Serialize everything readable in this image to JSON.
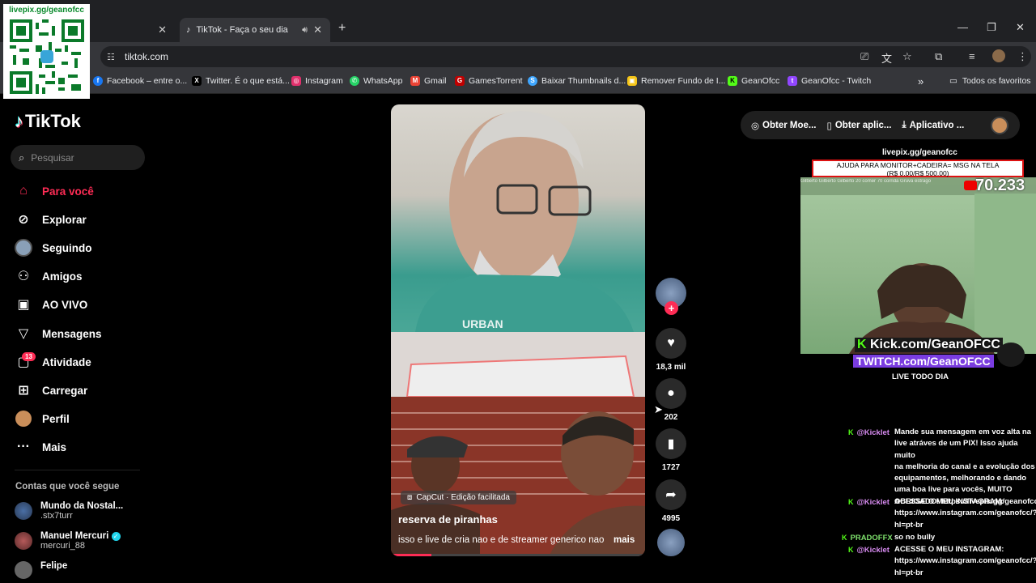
{
  "browser": {
    "tabs": [
      {
        "label": ""
      },
      {
        "label": "TikTok - Faça o seu dia"
      }
    ],
    "url": "tiktok.com",
    "bookmarks": [
      {
        "label": "Facebook – entre o...",
        "icon": "facebook-icon",
        "color": "#1877f2"
      },
      {
        "label": "Twitter. É o que está...",
        "icon": "x-icon",
        "color": "#000000"
      },
      {
        "label": "Instagram",
        "icon": "instagram-icon",
        "color": "#e1306c"
      },
      {
        "label": "WhatsApp",
        "icon": "whatsapp-icon",
        "color": "#25d366"
      },
      {
        "label": "Gmail",
        "icon": "gmail-icon",
        "color": "#ea4335"
      },
      {
        "label": "GamesTorrent",
        "icon": "gamestorrent-icon",
        "color": "#c00000"
      },
      {
        "label": "Baixar Thumbnails d...",
        "icon": "thumbnail-icon",
        "color": "#3ea6ff"
      },
      {
        "label": "Remover Fundo de I...",
        "icon": "remove-bg-icon",
        "color": "#f5c518"
      },
      {
        "label": "GeanOfcc",
        "icon": "kick-icon",
        "color": "#53fc18"
      },
      {
        "label": "GeanOfcc - Twitch",
        "icon": "twitch-icon",
        "color": "#9146ff"
      }
    ],
    "all_bookmarks": "Todos os favoritos"
  },
  "qr": {
    "text": "livepix.gg/geanofcc"
  },
  "sidebar": {
    "logo": "TikTok",
    "search_placeholder": "Pesquisar",
    "nav": [
      {
        "label": "Para você",
        "icon": "home-icon",
        "active": true
      },
      {
        "label": "Explorar",
        "icon": "compass-icon"
      },
      {
        "label": "Seguindo",
        "icon": "avatar-icon"
      },
      {
        "label": "Amigos",
        "icon": "friends-icon"
      },
      {
        "label": "AO VIVO",
        "icon": "live-icon"
      },
      {
        "label": "Mensagens",
        "icon": "message-icon"
      },
      {
        "label": "Atividade",
        "icon": "activity-icon",
        "badge": "13"
      },
      {
        "label": "Carregar",
        "icon": "upload-icon"
      },
      {
        "label": "Perfil",
        "icon": "profile-icon"
      },
      {
        "label": "Mais",
        "icon": "more-icon"
      }
    ],
    "following_title": "Contas que você segue",
    "accounts": [
      {
        "name": "Mundo da Nostal...",
        "user": ".stx7turr"
      },
      {
        "name": "Manuel Mercuri",
        "user": "mercuri_88",
        "verified": true
      },
      {
        "name": "Felipe",
        "user": ""
      }
    ]
  },
  "video": {
    "capcut_label": "CapCut · Edição facilitada",
    "title": "reserva de piranhas",
    "description": "isso e live de cria nao e de streamer generico nao",
    "more": "mais",
    "shirt_text": "URBAN",
    "progress": 0.16
  },
  "actions": {
    "likes": "18,3 mil",
    "comments": "202",
    "saves": "1727",
    "shares": "4995"
  },
  "top_pill": {
    "coins": "Obter Moe...",
    "app": "Obter aplic...",
    "desktop": "Aplicativo ..."
  },
  "stream": {
    "link": "livepix.gg/geanofcc",
    "banner_line1": "AJUDA PARA MONITOR+CADEIRA= MSG NA TELA",
    "banner_line2": "(R$ 0.00/R$ 500.00)",
    "counter": "70.233",
    "kick": "Kick.com/GeanOFCC",
    "twitch": "TWITCH.com/GeanOFCC",
    "live_daily": "LIVE TODO DIA"
  },
  "chat": [
    {
      "user": "@Kicklet",
      "lines": [
        "Mande sua mensagem em voz alta na",
        "live atráves de um PIX! Isso ajuda muito",
        "na melhoria do canal e a evolução dos",
        "equipamentos, melhorando e dando",
        "uma boa live para vocês, MUITO",
        "OBRIGADO! https://livepix.gg/geanofcc"
      ]
    },
    {
      "user": "@Kicklet",
      "lines": [
        "ACESSE O MEU INSTAGRAM:",
        "https://www.instagram.com/geanofcc/?",
        "hl=pt-br"
      ]
    },
    {
      "user": "PRADOFFX",
      "lines": [
        "so no bully"
      ]
    },
    {
      "user": "@Kicklet",
      "lines": [
        "ACESSE O MEU INSTAGRAM:",
        "https://www.instagram.com/geanofcc/?",
        "hl=pt-br"
      ]
    }
  ]
}
